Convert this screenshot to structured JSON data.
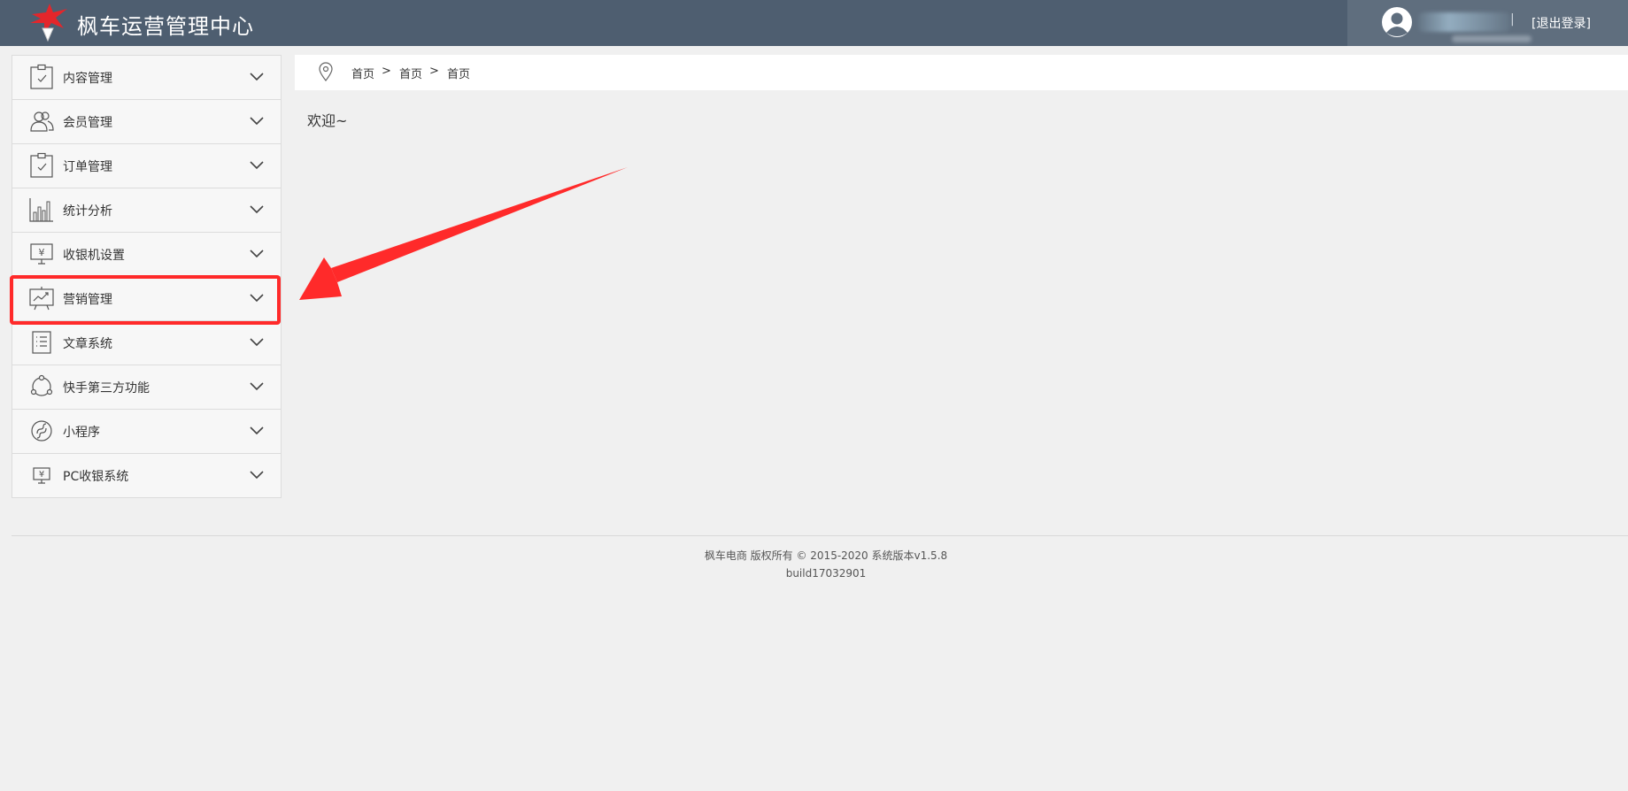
{
  "header": {
    "title": "枫车运营管理中心",
    "logout_label": "[退出登录]",
    "separator": "|"
  },
  "sidebar": {
    "items": [
      {
        "label": "内容管理",
        "icon": "clipboard-check-icon"
      },
      {
        "label": "会员管理",
        "icon": "users-icon"
      },
      {
        "label": "订单管理",
        "icon": "clipboard-check-icon"
      },
      {
        "label": "统计分析",
        "icon": "bar-chart-icon"
      },
      {
        "label": "收银机设置",
        "icon": "cashier-monitor-icon"
      },
      {
        "label": "营销管理",
        "icon": "marketing-board-icon"
      },
      {
        "label": "文章系统",
        "icon": "article-list-icon"
      },
      {
        "label": "快手第三方功能",
        "icon": "cycle-icon"
      },
      {
        "label": "小程序",
        "icon": "mini-program-icon"
      },
      {
        "label": "PC收银系统",
        "icon": "pc-cashier-icon"
      }
    ],
    "highlighted_index": 5
  },
  "breadcrumb": {
    "items": [
      "首页",
      "首页",
      "首页"
    ],
    "separator": ">"
  },
  "main": {
    "welcome_text": "欢迎~"
  },
  "footer": {
    "copyright": "枫车电商 版权所有 © 2015-2020 系统版本v1.5.8",
    "build": "build17032901"
  },
  "colors": {
    "header_bg": "#4e5e70",
    "page_bg": "#f0f0f0",
    "highlight": "#ff2a2a"
  }
}
